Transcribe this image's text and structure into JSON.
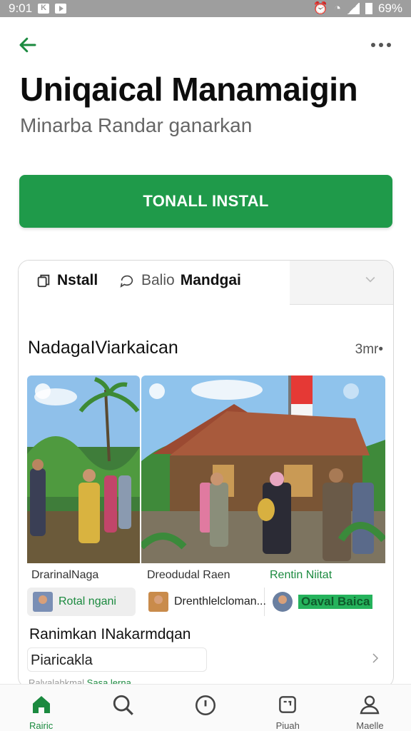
{
  "status_bar": {
    "time": "9:01",
    "battery": "69%"
  },
  "header": {
    "title": "Uniqaical Manamaigin",
    "subtitle": "Minarba Randar ganarkan"
  },
  "install_button": {
    "label": "TONALL INSTAL"
  },
  "card": {
    "tabs": [
      {
        "label": "Nstall"
      },
      {
        "label_prefix": "Balio",
        "label_bold": "Mandgai"
      }
    ],
    "section_title": "NadagaIViarkaican",
    "section_count": "3mr•",
    "captions": [
      "DrarinalNaga",
      "Dreodudal Raen",
      "Rentin Niitat"
    ],
    "chips": [
      "Rotal ngani",
      "Drenthlelcloman...",
      "Oaval Baica"
    ],
    "list_title": "Ranimkan INakarmdqan",
    "list_item": "Piaricakla",
    "list_faded_gray": "Ralvalahkmal",
    "list_faded_green": "Sasa lerna"
  },
  "bottom_nav": [
    {
      "label": "Rairic",
      "icon": "home-icon",
      "active": true
    },
    {
      "label": "",
      "icon": "search-icon",
      "active": false
    },
    {
      "label": "",
      "icon": "clock-icon",
      "active": false
    },
    {
      "label": "Piuah",
      "icon": "updates-icon",
      "active": false
    },
    {
      "label": "Maelle",
      "icon": "profile-icon",
      "active": false
    }
  ],
  "colors": {
    "accent": "#1f9a4a",
    "status_bar": "#9e9e9e"
  }
}
